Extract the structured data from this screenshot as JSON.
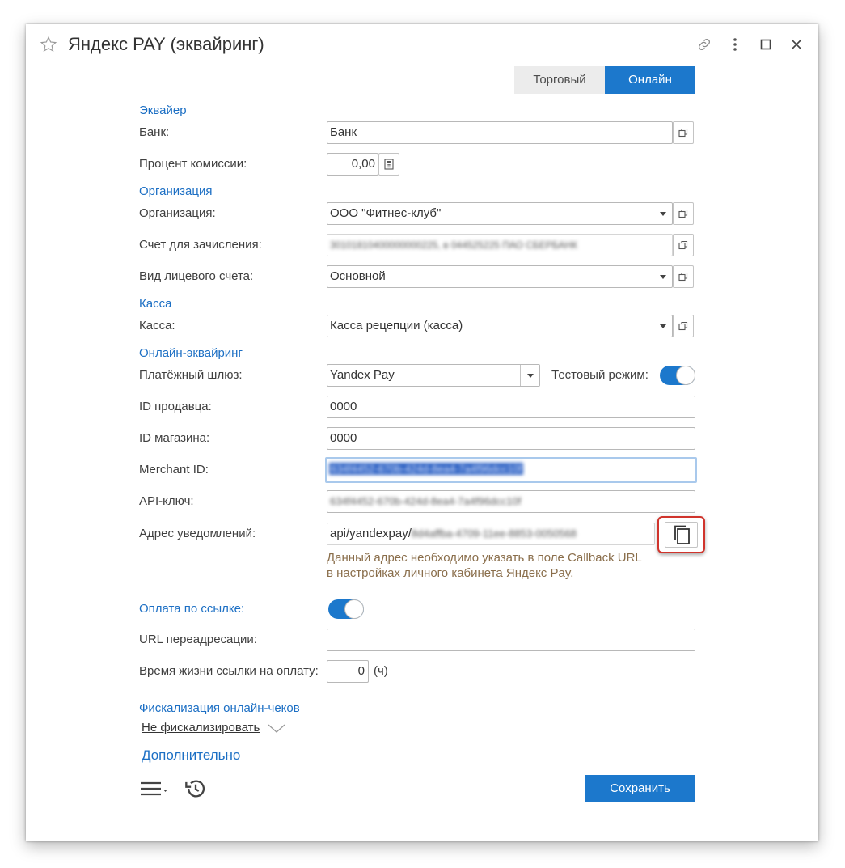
{
  "window": {
    "title": "Яндекс PAY (эквайринг)",
    "icons": [
      "star-icon",
      "link-icon",
      "more-vertical-icon",
      "maximize-icon",
      "close-icon"
    ]
  },
  "tabs": [
    {
      "label": "Торговый",
      "active": false
    },
    {
      "label": "Онлайн",
      "active": true
    }
  ],
  "sections": {
    "acquirer": "Эквайер",
    "organization": "Организация",
    "cash": "Касса",
    "online": "Онлайн-эквайринг",
    "fiscal": "Фискализация онлайн-чеков",
    "additional": "Дополнительно"
  },
  "fields": {
    "bank": {
      "label": "Банк:",
      "value": "Банк"
    },
    "commission": {
      "label": "Процент комиссии:",
      "value": "0,00"
    },
    "organization": {
      "label": "Организация:",
      "value": "ООО \"Фитнес-клуб\""
    },
    "account": {
      "label": "Счет для зачисления:",
      "value": "30101810400000000225, в 044525225 ПАО СБЕРБАНК"
    },
    "account_type": {
      "label": "Вид лицевого счета:",
      "value": "Основной"
    },
    "cashbox": {
      "label": "Касса:",
      "value": "Касса рецепции (касса)"
    },
    "gateway": {
      "label": "Платёжный шлюз:",
      "value": "Yandex Pay"
    },
    "test_mode": {
      "label": "Тестовый режим:",
      "enabled": true
    },
    "seller_id": {
      "label": "ID продавца:",
      "value": "0000"
    },
    "shop_id": {
      "label": "ID магазина:",
      "value": "0000"
    },
    "merchant_id": {
      "label": "Merchant ID:",
      "value": "634f4452-670b-424d-8ea4-7a4f96dcc10f"
    },
    "api_key": {
      "label": "API-ключ:",
      "value": "634f4452-670b-424d-8ea4-7a4f96dcc10f"
    },
    "notify_url": {
      "label": "Адрес уведомлений:",
      "value_prefix": "api/yandexpay/",
      "value_hidden": "8d4affba-4709-11ee-8853-0050568"
    },
    "notify_hint_1": "Данный адрес необходимо указать в поле Callback URL",
    "notify_hint_2": "в настройках личного кабинета Яндекс Pay.",
    "pay_by_link": {
      "label": "Оплата по ссылке:",
      "enabled": true
    },
    "redirect_url": {
      "label": "URL переадресации:",
      "value": ""
    },
    "link_lifetime": {
      "label": "Время жизни ссылки на оплату:",
      "value": "0",
      "unit": "(ч)"
    },
    "fiscal_mode": "Не фискализировать"
  },
  "footer": {
    "save": "Сохранить"
  },
  "colors": {
    "accent": "#1c78cc",
    "section": "#1c6fc4",
    "hint": "#8a6e4b",
    "highlight": "#d0342c"
  }
}
